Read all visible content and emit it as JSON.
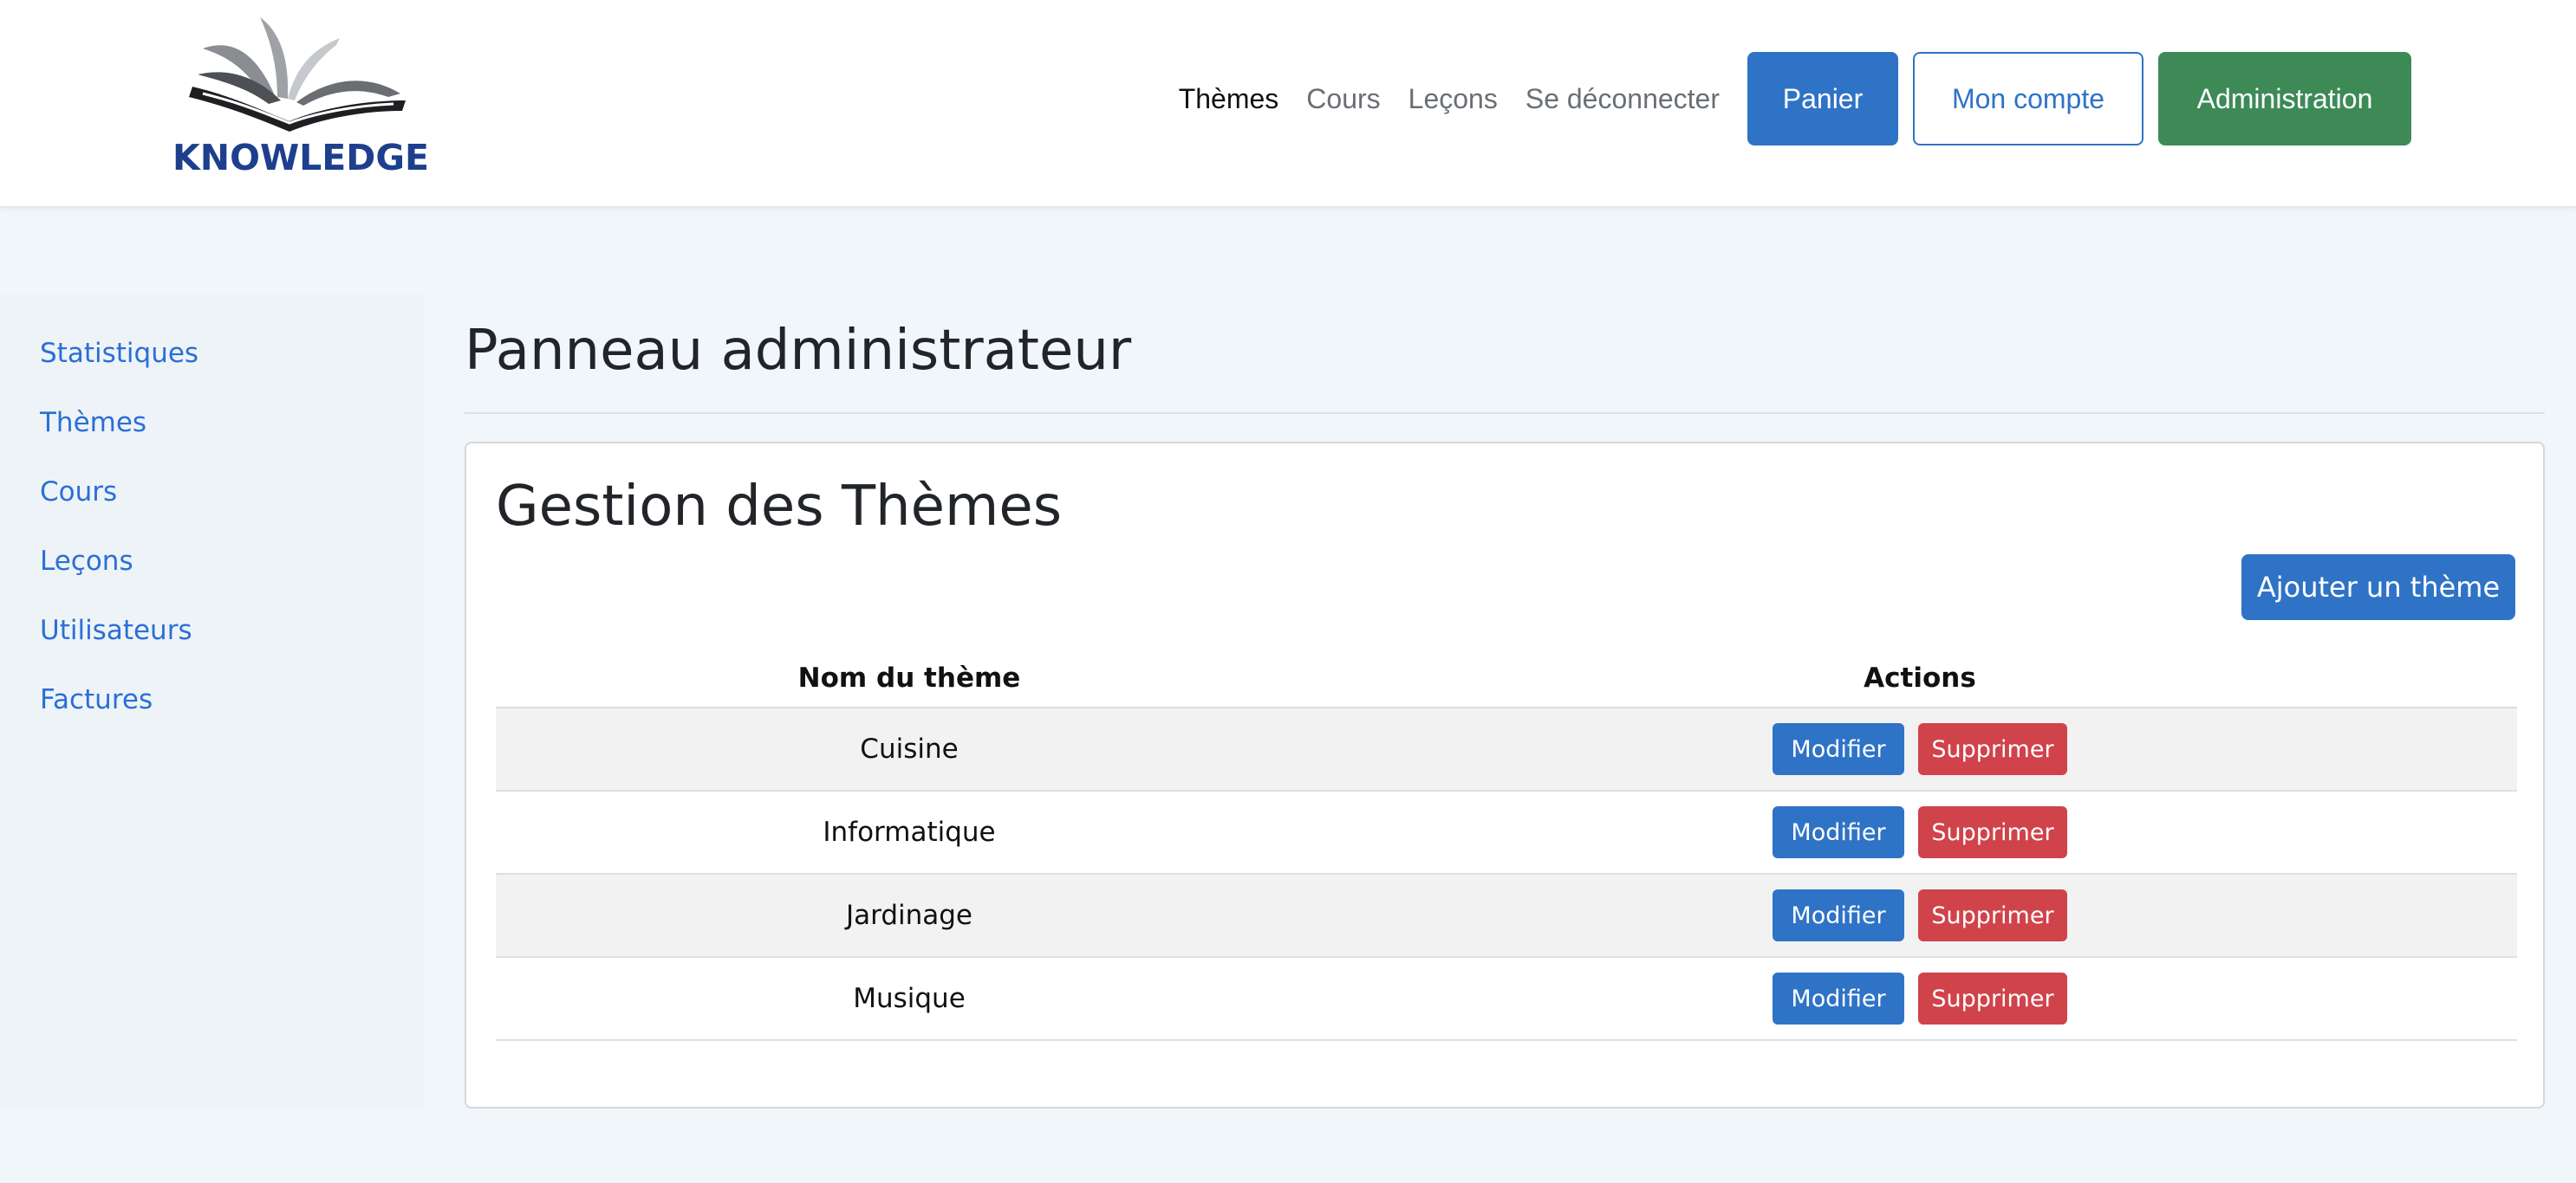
{
  "header": {
    "logo_text": "KNOWLEDGE",
    "nav": {
      "themes": "Thèmes",
      "cours": "Cours",
      "lecons": "Leçons",
      "logout": "Se déconnecter"
    },
    "buttons": {
      "cart": "Panier",
      "account": "Mon compte",
      "admin": "Administration"
    }
  },
  "sidebar": {
    "items": [
      {
        "label": "Statistiques"
      },
      {
        "label": "Thèmes"
      },
      {
        "label": "Cours"
      },
      {
        "label": "Leçons"
      },
      {
        "label": "Utilisateurs"
      },
      {
        "label": "Factures"
      }
    ]
  },
  "main": {
    "title": "Panneau administrateur",
    "card": {
      "title": "Gestion des Thèmes",
      "add_button": "Ajouter un thème",
      "table": {
        "headers": [
          "Nom du thème",
          "Actions"
        ],
        "rows": [
          {
            "name": "Cuisine",
            "edit": "Modifier",
            "delete": "Supprimer"
          },
          {
            "name": "Informatique",
            "edit": "Modifier",
            "delete": "Supprimer"
          },
          {
            "name": "Jardinage",
            "edit": "Modifier",
            "delete": "Supprimer"
          },
          {
            "name": "Musique",
            "edit": "Modifier",
            "delete": "Supprimer"
          }
        ]
      }
    }
  },
  "colors": {
    "primary": "#2f73c6",
    "success": "#3d8a57",
    "danger": "#d0434b",
    "logo": "#1d3f8e",
    "sidebar_link": "#2a6fd6"
  }
}
